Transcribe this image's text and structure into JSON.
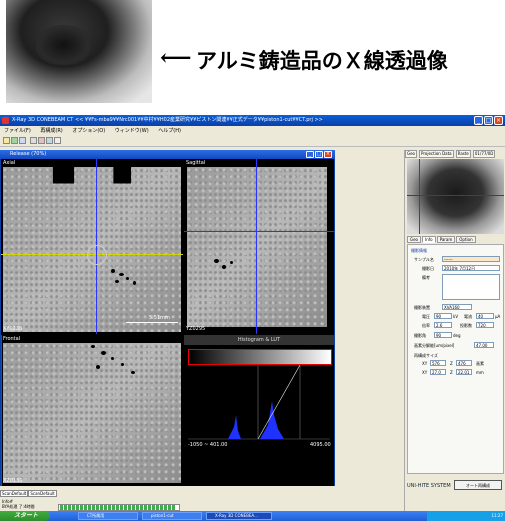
{
  "annotation": {
    "arrow": "⟵",
    "caption": "アルミ鋳造品のＸ線透過像"
  },
  "window": {
    "title": "X-Ray 3D CONEBEAM CT << ¥¥Fs-mba9¥¥Nrc001¥¥中村¥¥H02産業研究¥¥ピストン関連¥¥正式データ¥¥piston1-cut¥¥CT.prj >>",
    "min": "_",
    "max": "□",
    "close": "×"
  },
  "menu": [
    "ファイル(F)",
    "再構成(R)",
    "オプション(O)",
    "ウィンドウ(W)",
    "ヘルプ(H)"
  ],
  "release": {
    "title": "Release (70%)"
  },
  "views": {
    "axial": {
      "label": "Axial",
      "coord": "XY0238",
      "scale": "5.51mm"
    },
    "sagittal": {
      "label": "Sagittal",
      "coord": "YZ0295"
    },
    "frontal": {
      "label": "Frontal",
      "coord": "XZ0150"
    },
    "histogram": {
      "label": "Histogram & LUT",
      "range_left": "-1050 ~ 401.00",
      "range_right": "4095.00"
    }
  },
  "right_panel": {
    "top_tabs": [
      "Geo",
      "Projection Data",
      "Raste",
      "01/77/0D"
    ],
    "tabs": [
      "Geo",
      "Info",
      "Param",
      "Option"
    ],
    "active_tab": "Info",
    "section": "撮影情報",
    "sample_label": "サンプル名",
    "sample_value": "------",
    "date_label": "撮影日",
    "date_value": "2010年 7月12日",
    "note_label": "備考",
    "device_label": "撮影装置",
    "device_value": "XVA160",
    "voltage_label": "電圧",
    "voltage_value": "90",
    "voltage_unit": "kV",
    "current_label": "電流",
    "current_value": "40",
    "current_unit": "μA",
    "gain_label": "倍率",
    "gain_value": "2.6",
    "views_label": "投影数",
    "views_value": "720",
    "angle_label": "撮影角",
    "angle_value": "90",
    "angle_unit": "deg",
    "pixel_label": "画素分解能[um/pixel]",
    "pixel_value": "47.00",
    "recon_label": "再構成サイズ",
    "xy_label": "XY",
    "xy_value": "576",
    "z_label": "Z",
    "z_value": "476",
    "z_unit": "画素",
    "xy2_value": "27.0",
    "z2_value": "22.01",
    "mm_unit": "mm",
    "brand": "UNI-HITE SYSTEM",
    "auto_button": "オート再構成"
  },
  "bottom_tabs": [
    "ScanDefault",
    "ScanDefault"
  ],
  "status": {
    "line1": "Info#",
    "line2": "BYA処理 了:4時間",
    "progress": 0.98
  },
  "taskbar": {
    "start": "スタート",
    "tasks": [
      "CT所属用",
      "piston1-cut",
      "X-Ray 3D CONEBEA..."
    ],
    "clock": "11:27"
  }
}
